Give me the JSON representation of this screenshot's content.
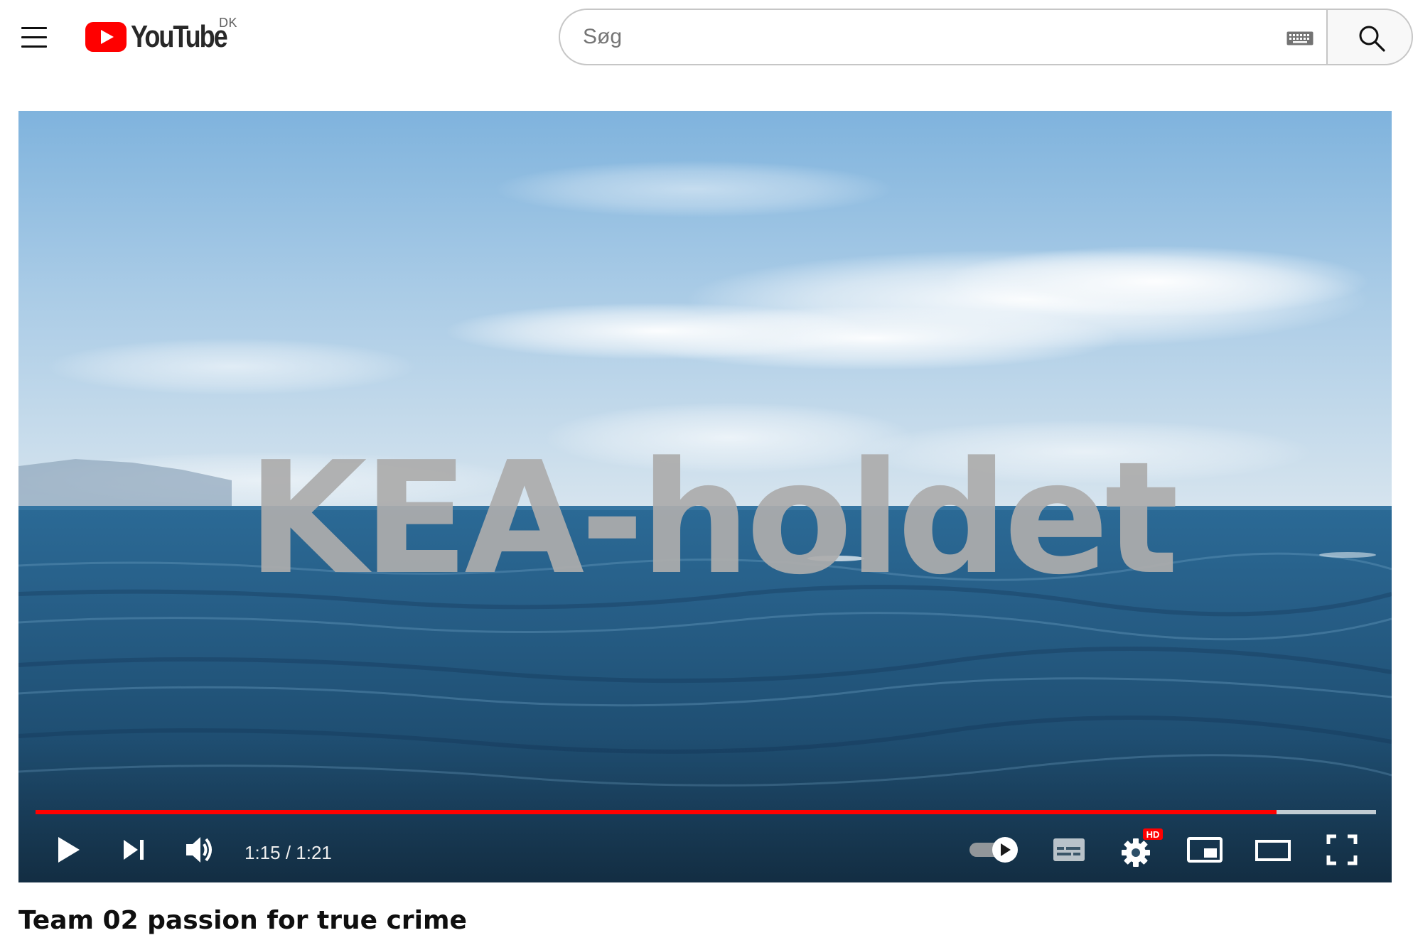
{
  "header": {
    "logo_text": "YouTube",
    "country_code": "DK",
    "search_placeholder": "Søg",
    "search_value": ""
  },
  "player": {
    "overlay_title": "KEA-holdet",
    "current_time": "1:15",
    "separator": " / ",
    "duration": "1:21",
    "progress_fraction": 0.926,
    "buffered_fraction": 1.0,
    "autoplay": "on",
    "quality_badge": "HD"
  },
  "video": {
    "title": "Team 02 passion for true crime"
  },
  "colors": {
    "brand_red": "#ff0000",
    "progress_red": "#ff0000",
    "text_primary": "#0f0f0f"
  },
  "icons": {
    "menu": "hamburger-menu-icon",
    "keyboard": "keyboard-icon",
    "search": "search-icon",
    "play": "play-icon",
    "next": "skip-next-icon",
    "volume": "volume-icon",
    "autoplay": "autoplay-toggle-icon",
    "subtitles": "subtitles-icon",
    "settings": "gear-icon",
    "miniplayer": "miniplayer-icon",
    "theater": "theater-mode-icon",
    "fullscreen": "fullscreen-icon"
  }
}
